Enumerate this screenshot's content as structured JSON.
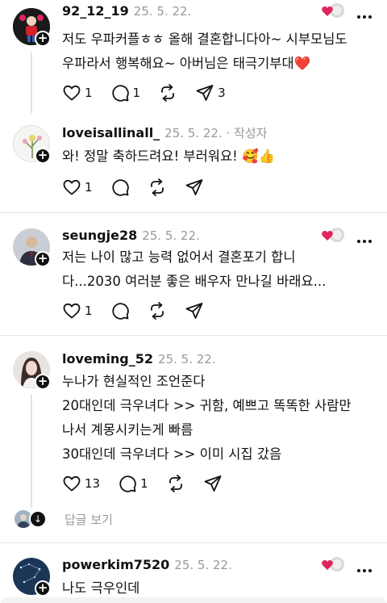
{
  "posts": [
    {
      "username": "92_12_19",
      "date": "25. 5. 22.",
      "author_tag": "",
      "lines": [
        "저도 우파커플ㅎㅎ 올해 결혼합니다아~ 시부모님도",
        "우파라서 행복해요~ 아버님은 태극기부대❤️"
      ],
      "likes": "1",
      "comments": "1",
      "reposts": "",
      "shares": "3",
      "avatar_icon": "person-with-red-flower-icon",
      "show_like_cluster": true
    },
    {
      "username": "loveisallinall_",
      "date": "25. 5. 22.",
      "author_tag": " · 작성자",
      "lines": [
        "와! 정말 축하드려요! 부러워요! 🥰👍"
      ],
      "likes": "1",
      "comments": "",
      "reposts": "",
      "shares": "",
      "avatar_icon": "floral-avatar-icon",
      "show_like_cluster": false
    },
    {
      "username": "seungje28",
      "date": "25. 5. 22.",
      "author_tag": "",
      "lines": [
        "저는 나이 많고 능력 없어서 결혼포기 합니",
        "다...2030 여러분 좋은 배우자 만나길 바래요..."
      ],
      "likes": "1",
      "comments": "",
      "reposts": "",
      "shares": "",
      "avatar_icon": "man-in-suit-avatar-icon",
      "show_like_cluster": true
    },
    {
      "username": "loveming_52",
      "date": "25. 5. 22.",
      "author_tag": "",
      "lines": [
        "누나가 현실적인 조언준다",
        "20대인데 극우녀다 >> 귀함, 예쁘고 똑똑한 사람만",
        "나서 계몽시키는게 빠름",
        "30대인데 극우녀다 >> 이미 시집 갔음"
      ],
      "likes": "13",
      "comments": "1",
      "reposts": "",
      "shares": "",
      "avatar_icon": "woman-avatar-icon",
      "show_like_cluster": false
    },
    {
      "username": "powerkim7520",
      "date": "25. 5. 22.",
      "author_tag": "",
      "lines": [
        "나도 극우인데"
      ],
      "likes": "",
      "comments": "",
      "reposts": "",
      "shares": "",
      "avatar_icon": "night-sky-avatar-icon",
      "show_like_cluster": true
    }
  ],
  "view_replies_label": "답글 보기",
  "colors": {
    "heart_red": "#e0245e",
    "muted": "#999999",
    "divider": "#e6e6e6"
  }
}
